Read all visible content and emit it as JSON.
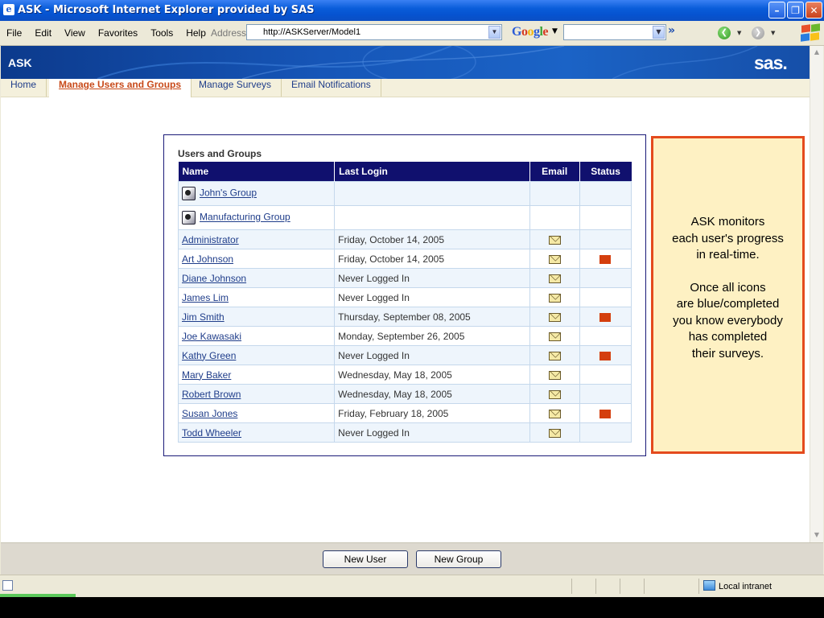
{
  "window": {
    "title": "ASK - Microsoft Internet Explorer provided by SAS"
  },
  "menu": [
    "File",
    "Edit",
    "View",
    "Favorites",
    "Tools",
    "Help"
  ],
  "address": {
    "label": "Address",
    "url": "http://ASKServer/Model1"
  },
  "google": {
    "logo": "Google"
  },
  "toolbar": {
    "more_label": "»"
  },
  "banner": {
    "app_name": "ASK",
    "logo": "sas."
  },
  "tabs": [
    {
      "label": "Home",
      "active": false
    },
    {
      "label": "Manage Users and Groups",
      "active": true
    },
    {
      "label": "Manage Surveys",
      "active": false
    },
    {
      "label": "Email Notifications",
      "active": false
    }
  ],
  "panel": {
    "title": "Users and Groups",
    "columns": {
      "name": "Name",
      "last_login": "Last Login",
      "email": "Email",
      "status": "Status"
    },
    "rows": [
      {
        "name": "John's Group",
        "last_login": "",
        "is_group": true,
        "email": false,
        "status": false
      },
      {
        "name": "Manufacturing Group",
        "last_login": "",
        "is_group": true,
        "email": false,
        "status": false
      },
      {
        "name": "Administrator",
        "last_login": "Friday, October 14, 2005",
        "is_group": false,
        "email": true,
        "status": false
      },
      {
        "name": "Art Johnson",
        "last_login": "Friday, October 14, 2005",
        "is_group": false,
        "email": true,
        "status": true
      },
      {
        "name": "Diane Johnson",
        "last_login": "Never Logged In",
        "is_group": false,
        "email": true,
        "status": false
      },
      {
        "name": "James Lim",
        "last_login": "Never Logged In",
        "is_group": false,
        "email": true,
        "status": false
      },
      {
        "name": "Jim Smith",
        "last_login": "Thursday, September 08, 2005",
        "is_group": false,
        "email": true,
        "status": true
      },
      {
        "name": "Joe Kawasaki",
        "last_login": "Monday, September 26, 2005",
        "is_group": false,
        "email": true,
        "status": false
      },
      {
        "name": "Kathy Green",
        "last_login": "Never Logged In",
        "is_group": false,
        "email": true,
        "status": true
      },
      {
        "name": "Mary Baker",
        "last_login": "Wednesday, May 18, 2005",
        "is_group": false,
        "email": true,
        "status": false
      },
      {
        "name": "Robert Brown",
        "last_login": "Wednesday, May 18, 2005",
        "is_group": false,
        "email": true,
        "status": false
      },
      {
        "name": "Susan Jones",
        "last_login": "Friday, February 18, 2005",
        "is_group": false,
        "email": true,
        "status": true
      },
      {
        "name": "Todd Wheeler",
        "last_login": "Never Logged In",
        "is_group": false,
        "email": true,
        "status": false
      }
    ]
  },
  "callout": {
    "paragraph1": [
      "ASK monitors",
      "each user's progress",
      "in real-time."
    ],
    "paragraph2": [
      "Once all icons",
      "are blue/completed",
      "you know everybody",
      "has completed",
      "their surveys."
    ]
  },
  "buttons": {
    "new_user": "New User",
    "new_group": "New Group"
  },
  "status_bar": {
    "zone": "Local intranet"
  },
  "colors": {
    "status_incomplete": "#D43F0E",
    "header_bg": "#10106E",
    "active_tab": "#C84A1A",
    "callout_border": "#E44A1D",
    "callout_bg": "#FEF1C3"
  }
}
